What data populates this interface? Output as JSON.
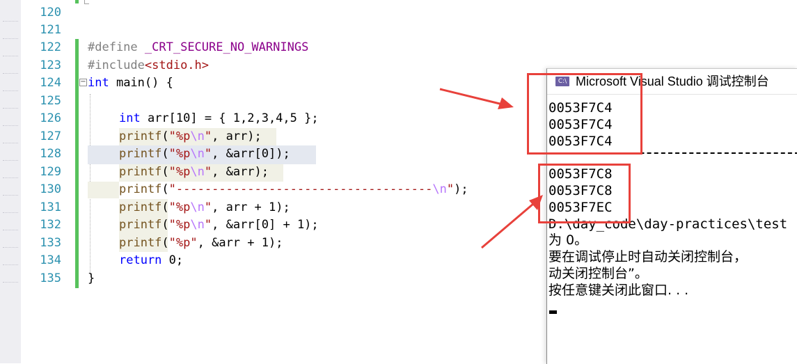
{
  "editor": {
    "lines": [
      {
        "num": "120"
      },
      {
        "num": "121"
      },
      {
        "num": "122"
      },
      {
        "num": "123"
      },
      {
        "num": "124"
      },
      {
        "num": "125"
      },
      {
        "num": "126"
      },
      {
        "num": "127"
      },
      {
        "num": "128"
      },
      {
        "num": "129"
      },
      {
        "num": "130"
      },
      {
        "num": "131"
      },
      {
        "num": "132"
      },
      {
        "num": "133"
      },
      {
        "num": "134"
      },
      {
        "num": "135"
      }
    ],
    "code": {
      "l122_directive": "#define",
      "l122_macro": "_CRT_SECURE_NO_WARNINGS",
      "l123_directive": "#include",
      "l123_header": "<stdio.h>",
      "l124_kw": "int",
      "l124_rest": " main() {",
      "l126_kw": "int",
      "l126_rest": " arr[10] = { 1,2,3,4,5 };",
      "printf": "printf",
      "l127_str": "\"%p",
      "l127_esc": "\\n",
      "l127_strend": "\"",
      "l127_rest": ", arr);",
      "l128_rest": ", &arr[0]);",
      "l129_rest": ", &arr);",
      "l130_str": "\"------------------------------------",
      "l130_esc": "\\n",
      "l130_rest": ");",
      "l131_rest": ", arr + 1);",
      "l132_rest": ", &arr[0] + 1);",
      "l133_str": "\"%p\"",
      "l133_rest": ", &arr + 1);",
      "l134_kw": "return",
      "l134_rest": " 0;",
      "l135": "}",
      "paren_open": "("
    },
    "collapse_symbol": "−"
  },
  "console": {
    "icon_text": "C:\\",
    "title": "Microsoft Visual Studio 调试控制台",
    "output_group1": [
      "0053F7C4",
      "0053F7C4",
      "0053F7C4"
    ],
    "output_group2": [
      "0053F7C8",
      "0053F7C8",
      "0053F7EC"
    ],
    "path_line": "D:\\day_code\\day-practices\\test",
    "exit_line": "为 0。",
    "hint_line1": "要在调试停止时自动关闭控制台，",
    "hint_line2": "动关闭控制台”。",
    "press_key": "按任意键关闭此窗口. . ."
  },
  "colors": {
    "keyword": "#0000ff",
    "string": "#a31515",
    "escape": "#b776fb",
    "macro": "#8b008b",
    "function": "#74531f",
    "line_number": "#2b91af",
    "annotation_red": "#e8413b",
    "change_bar": "#57c25c"
  }
}
